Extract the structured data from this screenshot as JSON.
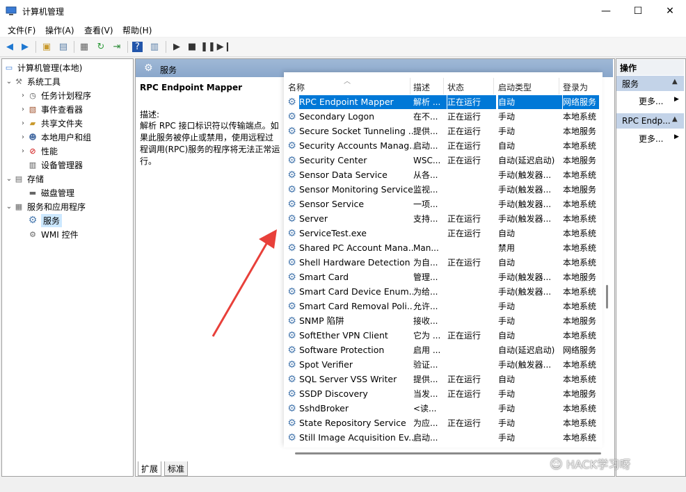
{
  "window": {
    "title": "计算机管理",
    "controls": {
      "minimize": "—",
      "maximize": "☐",
      "close": "✕"
    }
  },
  "menu": [
    "文件(F)",
    "操作(A)",
    "查看(V)",
    "帮助(H)"
  ],
  "tree": {
    "root": "计算机管理(本地)",
    "nodes": [
      {
        "label": "系统工具",
        "icon": "tools-icon"
      },
      {
        "label": "任务计划程序",
        "icon": "clock-icon"
      },
      {
        "label": "事件查看器",
        "icon": "event-viewer-icon"
      },
      {
        "label": "共享文件夹",
        "icon": "shared-folder-icon"
      },
      {
        "label": "本地用户和组",
        "icon": "users-icon"
      },
      {
        "label": "性能",
        "icon": "performance-icon"
      },
      {
        "label": "设备管理器",
        "icon": "device-manager-icon"
      },
      {
        "label": "存储",
        "icon": "storage-icon"
      },
      {
        "label": "磁盘管理",
        "icon": "disk-icon"
      },
      {
        "label": "服务和应用程序",
        "icon": "services-apps-icon"
      },
      {
        "label": "服务",
        "icon": "gear-icon"
      },
      {
        "label": "WMI 控件",
        "icon": "wmi-icon"
      }
    ]
  },
  "services_header": "服务",
  "detail": {
    "name": "RPC Endpoint Mapper",
    "desc_label": "描述:",
    "desc_text": "解析 RPC 接口标识符以传输端点。如果此服务被停止或禁用，使用远程过程调用(RPC)服务的程序将无法正常运行。"
  },
  "columns": {
    "name": "名称",
    "desc": "描述",
    "status": "状态",
    "start": "启动类型",
    "logon": "登录为"
  },
  "services": [
    {
      "name": "RPC Endpoint Mapper",
      "desc": "解析 ...",
      "status": "正在运行",
      "start": "自动",
      "logon": "网络服务"
    },
    {
      "name": "Secondary Logon",
      "desc": "在不...",
      "status": "正在运行",
      "start": "手动",
      "logon": "本地系统"
    },
    {
      "name": "Secure Socket Tunneling ...",
      "desc": "提供...",
      "status": "正在运行",
      "start": "手动",
      "logon": "本地服务"
    },
    {
      "name": "Security Accounts Manag...",
      "desc": "启动...",
      "status": "正在运行",
      "start": "自动",
      "logon": "本地系统"
    },
    {
      "name": "Security Center",
      "desc": "WSC...",
      "status": "正在运行",
      "start": "自动(延迟启动)",
      "logon": "本地服务"
    },
    {
      "name": "Sensor Data Service",
      "desc": "从各...",
      "status": "",
      "start": "手动(触发器...",
      "logon": "本地系统"
    },
    {
      "name": "Sensor Monitoring Service",
      "desc": "监视...",
      "status": "",
      "start": "手动(触发器...",
      "logon": "本地服务"
    },
    {
      "name": "Sensor Service",
      "desc": "一项...",
      "status": "",
      "start": "手动(触发器...",
      "logon": "本地系统"
    },
    {
      "name": "Server",
      "desc": "支持...",
      "status": "正在运行",
      "start": "手动(触发器...",
      "logon": "本地系统"
    },
    {
      "name": "ServiceTest.exe",
      "desc": "",
      "status": "正在运行",
      "start": "自动",
      "logon": "本地系统"
    },
    {
      "name": "Shared PC Account Mana...",
      "desc": "Man...",
      "status": "",
      "start": "禁用",
      "logon": "本地系统"
    },
    {
      "name": "Shell Hardware Detection",
      "desc": "为自...",
      "status": "正在运行",
      "start": "自动",
      "logon": "本地系统"
    },
    {
      "name": "Smart Card",
      "desc": "管理...",
      "status": "",
      "start": "手动(触发器...",
      "logon": "本地服务"
    },
    {
      "name": "Smart Card Device Enum...",
      "desc": "为给...",
      "status": "",
      "start": "手动(触发器...",
      "logon": "本地系统"
    },
    {
      "name": "Smart Card Removal Poli...",
      "desc": "允许...",
      "status": "",
      "start": "手动",
      "logon": "本地系统"
    },
    {
      "name": "SNMP 陷阱",
      "desc": "接收...",
      "status": "",
      "start": "手动",
      "logon": "本地服务"
    },
    {
      "name": "SoftEther VPN Client",
      "desc": "它为 ...",
      "status": "正在运行",
      "start": "自动",
      "logon": "本地系统"
    },
    {
      "name": "Software Protection",
      "desc": "启用 ...",
      "status": "",
      "start": "自动(延迟启动)",
      "logon": "网络服务"
    },
    {
      "name": "Spot Verifier",
      "desc": "验证...",
      "status": "",
      "start": "手动(触发器...",
      "logon": "本地系统"
    },
    {
      "name": "SQL Server VSS Writer",
      "desc": "提供...",
      "status": "正在运行",
      "start": "自动",
      "logon": "本地系统"
    },
    {
      "name": "SSDP Discovery",
      "desc": "当发...",
      "status": "正在运行",
      "start": "手动",
      "logon": "本地服务"
    },
    {
      "name": "SshdBroker",
      "desc": "<读...",
      "status": "",
      "start": "手动",
      "logon": "本地系统"
    },
    {
      "name": "State Repository Service",
      "desc": "为应...",
      "status": "正在运行",
      "start": "手动",
      "logon": "本地系统"
    },
    {
      "name": "Still Image Acquisition Ev...",
      "desc": "启动...",
      "status": "",
      "start": "手动",
      "logon": "本地系统"
    }
  ],
  "tabs": [
    "扩展",
    "标准"
  ],
  "actions": {
    "title": "操作",
    "group1": "服务",
    "more1": "更多...",
    "group2": "RPC Endp...",
    "more2": "更多..."
  },
  "watermark": "HACK学习呀",
  "colors": {
    "selection": "#0078d7",
    "header": "#9fb8d6",
    "arrow": "#e8403a"
  }
}
